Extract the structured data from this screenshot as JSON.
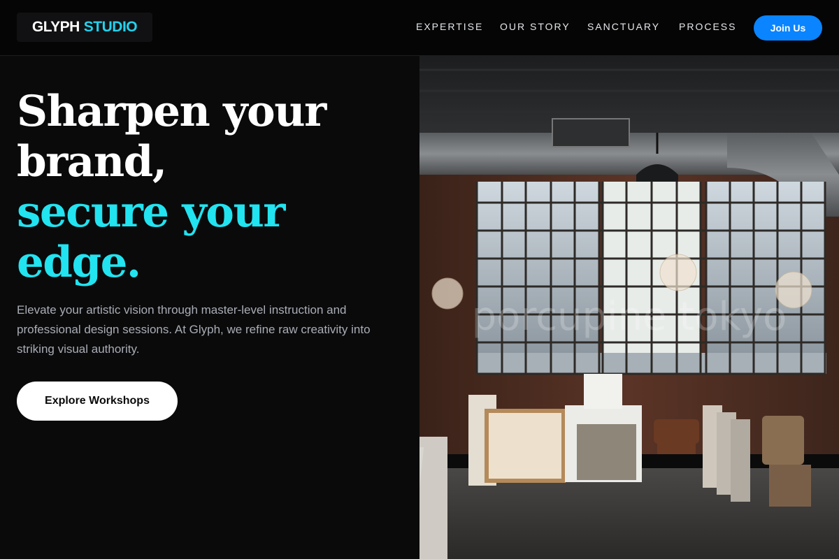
{
  "brand": {
    "name_part1": "GLYPH",
    "name_part2": "STUDIO",
    "accent": "#22d3ee"
  },
  "nav": {
    "items": [
      {
        "label": "EXPERTISE"
      },
      {
        "label": "OUR STORY"
      },
      {
        "label": "SANCTUARY"
      },
      {
        "label": "PROCESS"
      }
    ],
    "join_label": "Join Us"
  },
  "hero": {
    "headline_lines": [
      "Sharpen your",
      "brand,"
    ],
    "headline_accent_lines": [
      "secure your",
      "edge."
    ],
    "subtitle": "Elevate your artistic vision through master-level instruction and professional design sessions. At Glyph, we refine raw creativity into striking visual authority.",
    "cta_label": "Explore Workshops"
  },
  "image": {
    "watermark": "porcupine tokyo"
  },
  "colors": {
    "cta_blue": "#0a84ff",
    "accent_cyan": "#22e3f0",
    "background": "#0a0a0b"
  }
}
